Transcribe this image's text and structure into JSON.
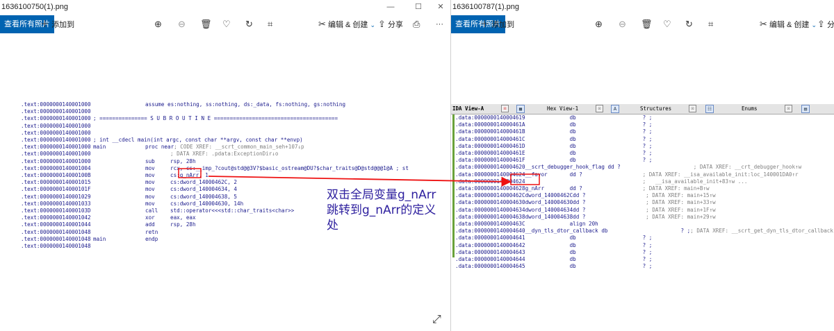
{
  "left": {
    "title": "1636100750(1).png",
    "toolbar": {
      "see_all": "查看所有照片",
      "add": "添加到",
      "edit_create": "编辑 & 创建",
      "share": "分享",
      "more": "···"
    },
    "code": [
      {
        "addr": ".text:0000000140001000",
        "label": "",
        "mn": "assume es:nothing, ss:nothing, ds:_data, fs:nothing, gs:nothing",
        "ops": "",
        "cm": ""
      },
      {
        "addr": ".text:0000000140001000",
        "label": "",
        "mn": "",
        "ops": "",
        "cm": ""
      },
      {
        "addr": ".text:0000000140001000",
        "label": "; =============== S U B R O U T I N E =======================================",
        "mn": "",
        "ops": "",
        "cm": ""
      },
      {
        "addr": ".text:0000000140001000",
        "label": "",
        "mn": "",
        "ops": "",
        "cm": ""
      },
      {
        "addr": ".text:0000000140001000",
        "label": "",
        "mn": "",
        "ops": "",
        "cm": ""
      },
      {
        "addr": ".text:0000000140001000",
        "label": "; int __cdecl main(int argc, const char **argv, const char **envp)",
        "mn": "",
        "ops": "",
        "cm": ""
      },
      {
        "addr": ".text:0000000140001000",
        "label": "main",
        "mn": "proc near",
        "ops": "",
        "cm": "; CODE XREF: __scrt_common_main_seh+107↓p"
      },
      {
        "addr": ".text:0000000140001000",
        "label": "",
        "mn": "",
        "ops": "",
        "cm": "; DATA XREF: .pdata:ExceptionDir↓o"
      },
      {
        "addr": ".text:0000000140001000",
        "label": "",
        "mn": "sub",
        "ops": "rsp, 28h",
        "cm": ""
      },
      {
        "addr": ".text:0000000140001004",
        "label": "",
        "mn": "mov",
        "ops": "rcx, cs:__imp_?cout@std@@3V?$basic_ostream@DU?$char_traits@D@std@@@1@A ; st",
        "cm": ""
      },
      {
        "addr": ".text:000000014000100B",
        "label": "",
        "mn": "mov",
        "ops": "cs:g_nArr, 1",
        "cm": ""
      },
      {
        "addr": ".text:0000000140001015",
        "label": "",
        "mn": "mov",
        "ops": "cs:dword_14000462C, 2",
        "cm": ""
      },
      {
        "addr": ".text:000000014000101F",
        "label": "",
        "mn": "mov",
        "ops": "cs:dword_140004634, 4",
        "cm": ""
      },
      {
        "addr": ".text:0000000140001029",
        "label": "",
        "mn": "mov",
        "ops": "cs:dword_140004638, 5",
        "cm": ""
      },
      {
        "addr": ".text:0000000140001033",
        "label": "",
        "mn": "mov",
        "ops": "cs:dword_140004630, 14h",
        "cm": ""
      },
      {
        "addr": ".text:000000014000103D",
        "label": "",
        "mn": "call",
        "ops": "std::operator<<<std::char_traits<char>>",
        "cm": ""
      },
      {
        "addr": ".text:0000000140001042",
        "label": "",
        "mn": "xor",
        "ops": "eax, eax",
        "cm": ""
      },
      {
        "addr": ".text:0000000140001044",
        "label": "",
        "mn": "add",
        "ops": "rsp, 28h",
        "cm": ""
      },
      {
        "addr": ".text:0000000140001048",
        "label": "",
        "mn": "retn",
        "ops": "",
        "cm": ""
      },
      {
        "addr": ".text:0000000140001048",
        "label": "main",
        "mn": "endp",
        "ops": "",
        "cm": ""
      },
      {
        "addr": ".text:0000000140001048",
        "label": "",
        "mn": "",
        "ops": "",
        "cm": ""
      }
    ],
    "annotation": "双击全局变量g_nArr\n跳转到g_nArr的定义\n处"
  },
  "right": {
    "title": "1636100787(1).png",
    "toolbar": {
      "see_all": "查看所有照片",
      "add": "添加到",
      "edit_create": "编辑 & 创建",
      "share": "分"
    },
    "tabs": [
      {
        "label": "IDA View-A",
        "close": "☒"
      },
      {
        "label": "Hex View-1",
        "close": "☒"
      },
      {
        "label": "Structures",
        "close": "☒"
      },
      {
        "label": "Enums",
        "close": "☒"
      }
    ],
    "code": [
      {
        "addr": ".data:0000000140004619",
        "label": "",
        "mn": "db",
        "ops": "? ;",
        "cm": ""
      },
      {
        "addr": ".data:000000014000461A",
        "label": "",
        "mn": "db",
        "ops": "? ;",
        "cm": ""
      },
      {
        "addr": ".data:000000014000461B",
        "label": "",
        "mn": "db",
        "ops": "? ;",
        "cm": ""
      },
      {
        "addr": ".data:000000014000461C",
        "label": "",
        "mn": "db",
        "ops": "? ;",
        "cm": ""
      },
      {
        "addr": ".data:000000014000461D",
        "label": "",
        "mn": "db",
        "ops": "? ;",
        "cm": ""
      },
      {
        "addr": ".data:000000014000461E",
        "label": "",
        "mn": "db",
        "ops": "? ;",
        "cm": ""
      },
      {
        "addr": ".data:000000014000461F",
        "label": "",
        "mn": "db",
        "ops": "? ;",
        "cm": ""
      },
      {
        "addr": ".data:0000000140004620",
        "label": "__scrt_debugger_hook_flag dd ?",
        "mn": "",
        "ops": "",
        "cm": "; DATA XREF: __crt_debugger_hook↑w"
      },
      {
        "addr": ".data:0000000140004624",
        "label": "__favor",
        "mn": "dd ?",
        "ops": "",
        "cm": "; DATA XREF: __isa_available_init:loc_140001DA0↑r"
      },
      {
        "addr": ".data:0000000140004624",
        "label": "",
        "mn": "",
        "ops": "",
        "cm": ";   __isa_available_init+83↑w ..."
      },
      {
        "addr": ".data:0000000140004628",
        "label": "g_nArr",
        "mn": "dd ?",
        "ops": "",
        "cm": "; DATA XREF: main+B↑w"
      },
      {
        "addr": ".data:000000014000462C",
        "label": "dword_14000462C",
        "mn": "dd ?",
        "ops": "",
        "cm": "; DATA XREF: main+15↑w"
      },
      {
        "addr": ".data:0000000140004630",
        "label": "dword_140004630",
        "mn": "dd ?",
        "ops": "",
        "cm": "; DATA XREF: main+33↑w"
      },
      {
        "addr": ".data:0000000140004634",
        "label": "dword_140004634",
        "mn": "dd ?",
        "ops": "",
        "cm": "; DATA XREF: main+1F↑w"
      },
      {
        "addr": ".data:0000000140004638",
        "label": "dword_140004638",
        "mn": "dd ?",
        "ops": "",
        "cm": "; DATA XREF: main+29↑w"
      },
      {
        "addr": ".data:000000014000463C",
        "label": "",
        "mn": "align 20h",
        "ops": "",
        "cm": ""
      },
      {
        "addr": ".data:0000000140004640",
        "label": "__dyn_tls_dtor_callback db",
        "mn": "",
        "ops": "? ;",
        "cm": "; DATA XREF: __scrt_get_dyn_tls_dtor_callback↑o"
      },
      {
        "addr": ".data:0000000140004641",
        "label": "",
        "mn": "db",
        "ops": "? ;",
        "cm": ""
      },
      {
        "addr": ".data:0000000140004642",
        "label": "",
        "mn": "db",
        "ops": "? ;",
        "cm": ""
      },
      {
        "addr": ".data:0000000140004643",
        "label": "",
        "mn": "db",
        "ops": "? ;",
        "cm": ""
      },
      {
        "addr": ".data:0000000140004644",
        "label": "",
        "mn": "db",
        "ops": "? ;",
        "cm": ""
      },
      {
        "addr": ".data:0000000140004645",
        "label": "",
        "mn": "db",
        "ops": "? ;",
        "cm": ""
      }
    ]
  },
  "watermark": "看",
  "colors": {
    "accent": "#0063b1",
    "highlight": "#ff0000",
    "code": "#1a1a8c",
    "comment": "#808080"
  }
}
